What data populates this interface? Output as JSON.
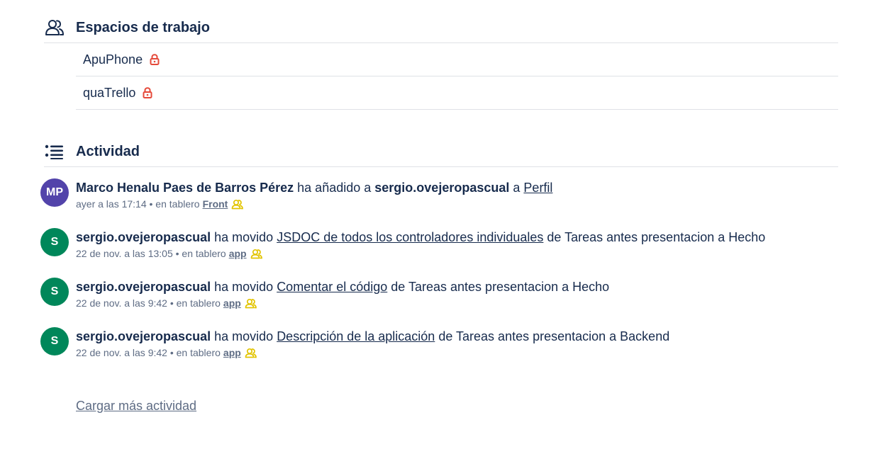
{
  "workspaces": {
    "title": "Espacios de trabajo",
    "items": [
      {
        "label": "ApuPhone"
      },
      {
        "label": "quaTrello"
      }
    ]
  },
  "activity": {
    "title": "Actividad",
    "items": [
      {
        "avatar": {
          "initials": "MP",
          "color": "#5243aa"
        },
        "member": "Marco Henalu Paes de Barros Pérez",
        "action": "ha añadido a",
        "target_member": "sergio.ovejeropascual",
        "joiner": "a",
        "link": "Perfil",
        "tail": "",
        "time": "ayer a las 17:14",
        "board_prefix": "• en tablero",
        "board": "Front"
      },
      {
        "avatar": {
          "initials": "S",
          "color": "#00875a"
        },
        "member": "sergio.ovejeropascual",
        "action": "ha movido",
        "link": "JSDOC de todos los controladores individuales",
        "tail": "de Tareas antes presentacion a Hecho",
        "time": "22 de nov. a las 13:05",
        "board_prefix": "• en tablero",
        "board": "app"
      },
      {
        "avatar": {
          "initials": "S",
          "color": "#00875a"
        },
        "member": "sergio.ovejeropascual",
        "action": "ha movido",
        "link": "Comentar el código",
        "tail": "de Tareas antes presentacion a Hecho",
        "time": "22 de nov. a las 9:42",
        "board_prefix": "• en tablero",
        "board": "app"
      },
      {
        "avatar": {
          "initials": "S",
          "color": "#00875a"
        },
        "member": "sergio.ovejeropascual",
        "action": "ha movido",
        "link": "Descripción de la aplicación",
        "tail": "de Tareas antes presentacion a Backend",
        "time": "22 de nov. a las 9:42",
        "board_prefix": "• en tablero",
        "board": "app"
      }
    ],
    "load_more": "Cargar más actividad"
  },
  "colors": {
    "text": "#172b4d",
    "muted": "#5e6c84",
    "lock": "#e5493a",
    "team_icon": "#e2c400",
    "divider": "#dfe1e6"
  }
}
